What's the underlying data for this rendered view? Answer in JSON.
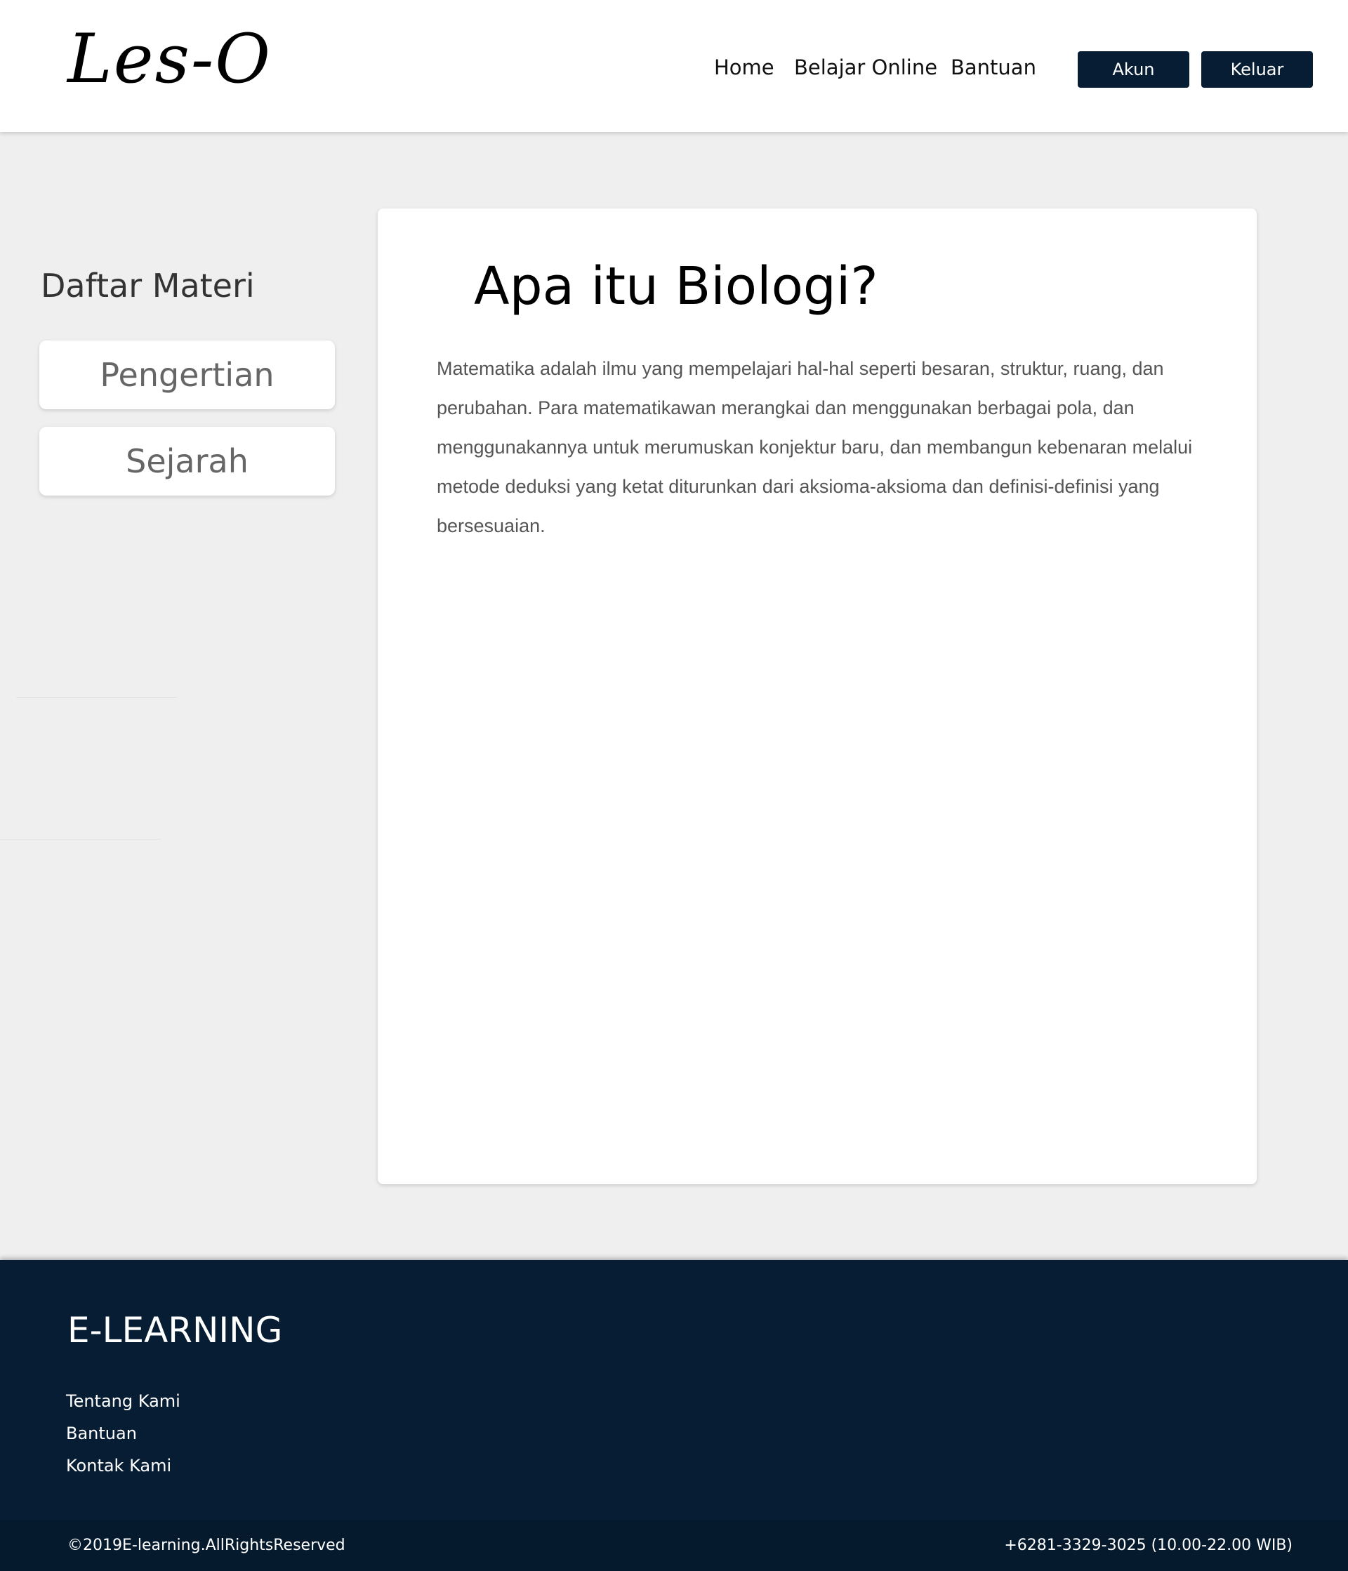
{
  "header": {
    "logo": "Les-O",
    "nav": {
      "home": "Home",
      "belajar_online": "Belajar Online",
      "bantuan": "Bantuan"
    },
    "buttons": {
      "akun": "Akun",
      "keluar": "Keluar"
    }
  },
  "sidebar": {
    "title": "Daftar Materi",
    "items": [
      {
        "label": "Pengertian"
      },
      {
        "label": "Sejarah"
      }
    ]
  },
  "content": {
    "title": "Apa itu Biologi?",
    "body": "Matematika adalah ilmu yang mempelajari hal-hal seperti besaran, struktur, ruang, dan perubahan. Para matematikawan merangkai dan menggunakan berbagai pola, dan menggunakannya untuk merumuskan konjektur baru, dan membangun kebenaran melalui metode deduksi yang ketat diturunkan dari aksioma-aksioma dan definisi-definisi yang bersesuaian."
  },
  "footer": {
    "title": "E-LEARNING",
    "links": [
      {
        "label": "Tentang Kami"
      },
      {
        "label": "Bantuan"
      },
      {
        "label": "Kontak Kami"
      }
    ],
    "copyright": "©2019E-learning.AllRightsReserved",
    "contact": "+6281-3329-3025 (10.00-22.00 WIB)"
  },
  "colors": {
    "navy": "#071d33",
    "background": "#efefef",
    "card": "#ffffff"
  }
}
